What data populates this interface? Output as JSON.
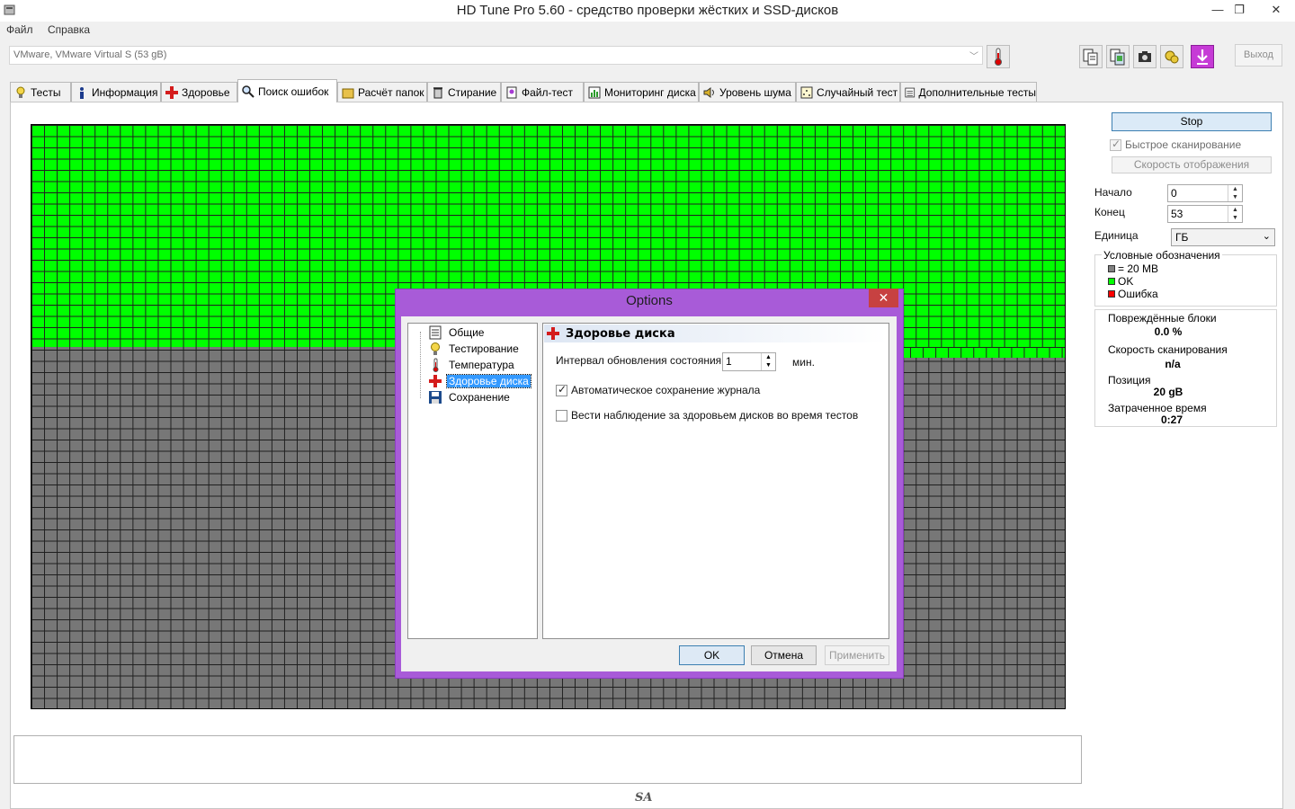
{
  "window": {
    "title": "HD Tune Pro 5.60 - средство проверки жёстких и SSD-дисков",
    "controls": [
      "—",
      "❐",
      "✕"
    ]
  },
  "menu": [
    "Файл",
    "Справка"
  ],
  "drive": {
    "selected": "VMware, VMware Virtual S (53 gB)"
  },
  "toolbar": {
    "icons": [
      "thermometer-icon",
      "copy-text-icon",
      "copy-image-icon",
      "camera-icon",
      "options-icon",
      "save-down-icon"
    ],
    "exit_label": "Выход"
  },
  "tabs": [
    {
      "label": "Тесты",
      "icon": "bulb-icon"
    },
    {
      "label": "Информация",
      "icon": "info-icon"
    },
    {
      "label": "Здоровье",
      "icon": "health-cross-icon"
    },
    {
      "label": "Поиск ошибок",
      "icon": "magnifier-icon",
      "active": true
    },
    {
      "label": "Расчёт папок",
      "icon": "folder-icon"
    },
    {
      "label": "Стирание",
      "icon": "trash-icon"
    },
    {
      "label": "Файл-тест",
      "icon": "file-test-icon"
    },
    {
      "label": "Мониторинг диска",
      "icon": "chart-icon"
    },
    {
      "label": "Уровень шума",
      "icon": "speaker-icon"
    },
    {
      "label": "Случайный тест",
      "icon": "random-icon"
    },
    {
      "label": "Дополнительные тесты",
      "icon": "extra-tests-icon"
    }
  ],
  "scan": {
    "progress_fraction": 0.376,
    "colors": {
      "ok": "#00ff00",
      "pending": "#777777",
      "error": "#ff0000"
    }
  },
  "right_panel": {
    "stop_label": "Stop",
    "quick_scan_label": "Быстрое сканирование",
    "quick_scan_checked": true,
    "speed_label": "Скорость отображения",
    "start_label": "Начало",
    "start_value": "0",
    "end_label": "Конец",
    "end_value": "53",
    "unit_label": "Единица",
    "unit_value": "ГБ",
    "legend_title": "Условные обозначения",
    "legend": [
      {
        "label": "= 20 MB",
        "color": "#808080"
      },
      {
        "label": "OK",
        "color": "#00ff00"
      },
      {
        "label": "Ошибка",
        "color": "#ff0000"
      }
    ],
    "stats": {
      "damaged_label": "Повреждённые блоки",
      "damaged_value": "0.0 %",
      "speed_label": "Скорость сканирования",
      "speed_value": "n/a",
      "position_label": "Позиция",
      "position_value": "20 gB",
      "elapsed_label": "Затраченное время",
      "elapsed_value": "0:27"
    }
  },
  "footer": {
    "logo": "SA"
  },
  "dialog": {
    "title": "Options",
    "close": "✕",
    "tree": [
      {
        "label": "Общие",
        "icon": "general-icon"
      },
      {
        "label": "Тестирование",
        "icon": "bulb-icon"
      },
      {
        "label": "Температура",
        "icon": "thermometer-icon"
      },
      {
        "label": "Здоровье диска",
        "icon": "health-cross-icon",
        "selected": true
      },
      {
        "label": "Сохранение",
        "icon": "floppy-icon"
      }
    ],
    "section_title": "Здоровье диска",
    "interval_label": "Интервал обновления состояния",
    "interval_value": "1",
    "interval_unit": "мин.",
    "autosave_label": "Автоматическое сохранение журнала",
    "autosave_checked": true,
    "monitor_label": "Вести наблюдение за здоровьем дисков во время тестов",
    "monitor_checked": false,
    "ok_label": "OK",
    "cancel_label": "Отмена",
    "apply_label": "Применить"
  }
}
